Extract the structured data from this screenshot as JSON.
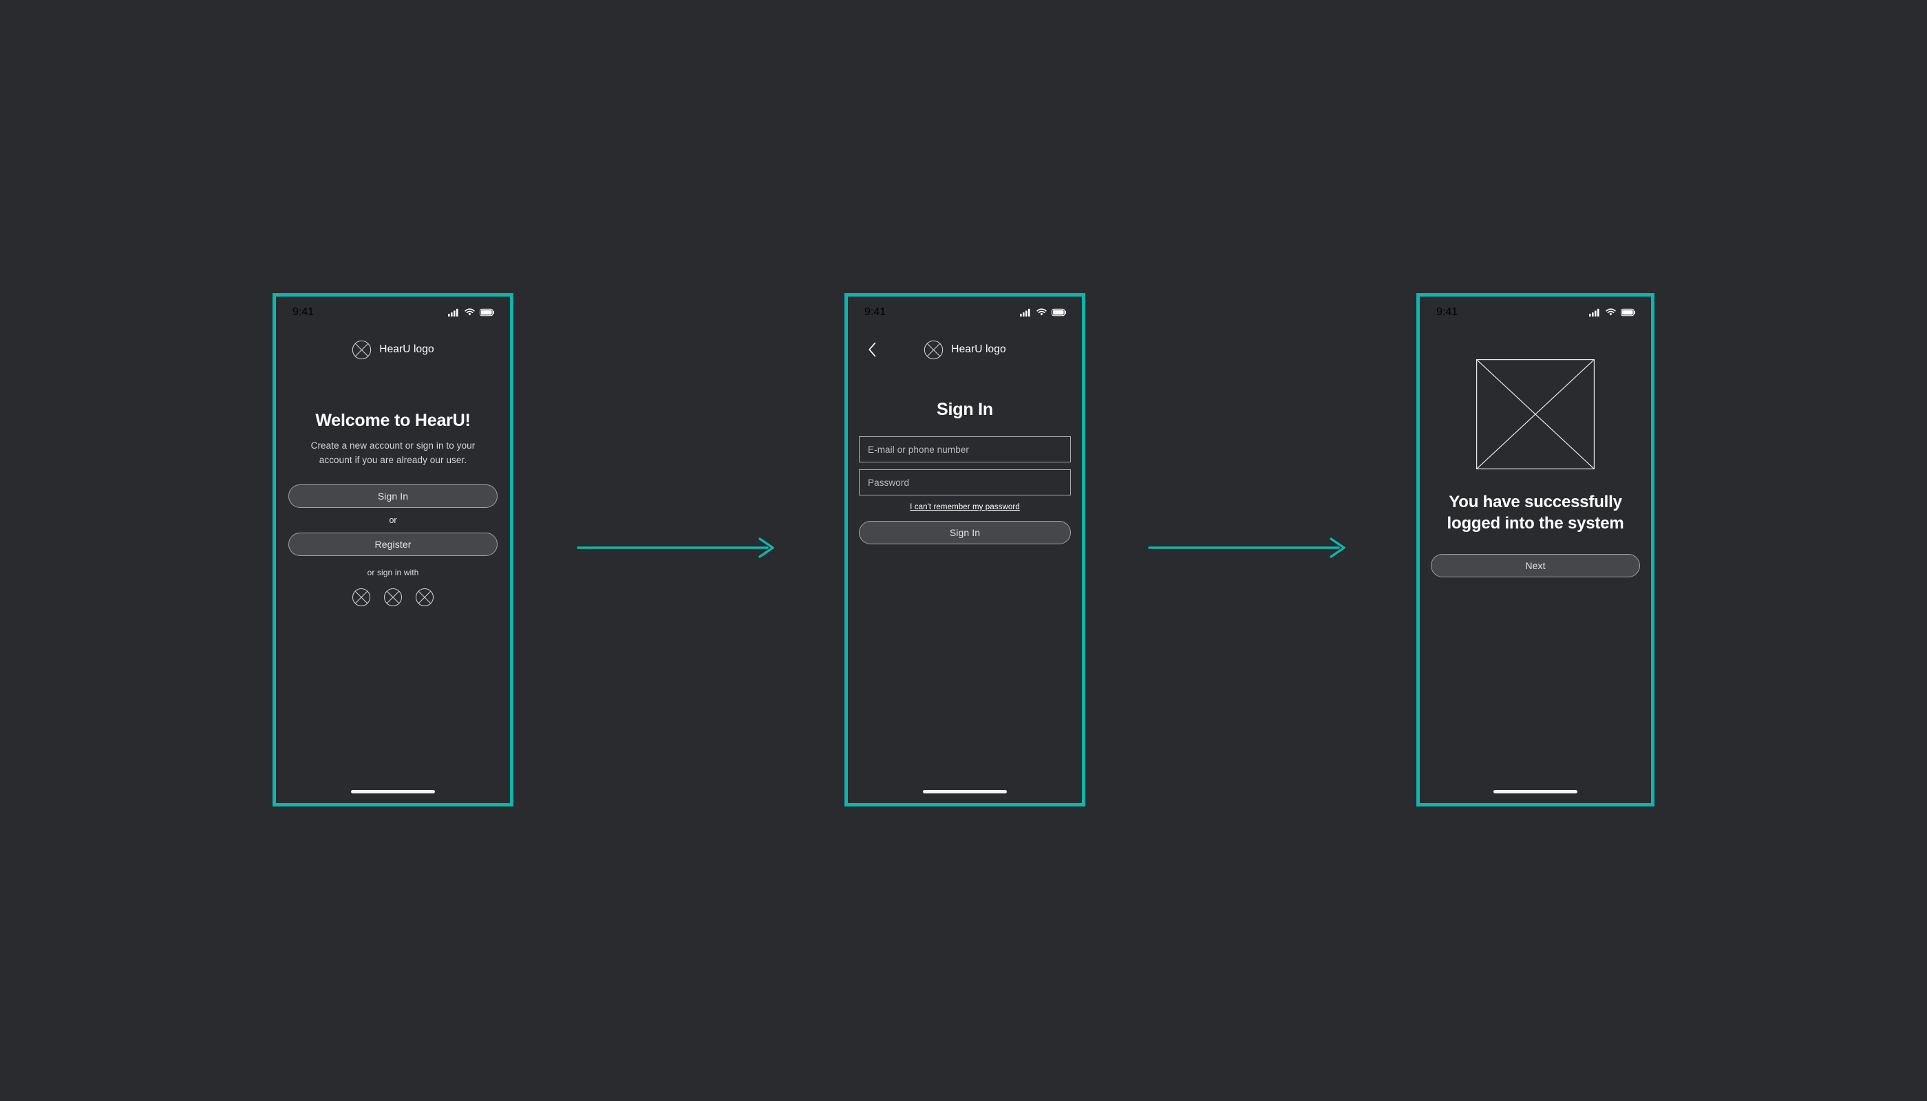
{
  "theme": {
    "background": "#292b2f",
    "accent": "#11b5ab",
    "button_fill": "#45474b",
    "stroke": "#a8abaf",
    "text": "#ffffff"
  },
  "status_bar": {
    "time": "9:41",
    "cellular_icon": "cellular-signal-icon",
    "wifi_icon": "wifi-icon",
    "battery_icon": "battery-icon"
  },
  "screens": [
    {
      "name": "welcome",
      "brand": {
        "logo_icon": "hearu-logo-placeholder-icon",
        "label": "HearU logo"
      },
      "headline": "Welcome to HearU!",
      "subtext": "Create a new account or sign in to your account if you are already our user.",
      "primary_button": "Sign In",
      "divider_label": "or",
      "secondary_button": "Register",
      "social_prompt": "or sign in with",
      "social_icons": [
        "social-provider-1-icon",
        "social-provider-2-icon",
        "social-provider-3-icon"
      ]
    },
    {
      "name": "sign-in",
      "back_icon": "chevron-left-icon",
      "brand": {
        "logo_icon": "hearu-logo-placeholder-icon",
        "label": "HearU logo"
      },
      "headline": "Sign In",
      "fields": [
        {
          "name": "email-or-phone",
          "value": "",
          "placeholder": "E-mail or phone number"
        },
        {
          "name": "password",
          "value": "",
          "placeholder": "Password"
        }
      ],
      "forgot_link": "I can't remember my password",
      "primary_button": "Sign In"
    },
    {
      "name": "success",
      "image_placeholder_icon": "image-placeholder-icon",
      "headline": "You have successfully logged into the system",
      "primary_button": "Next"
    }
  ],
  "flow_arrows": [
    {
      "name": "arrow-welcome-to-signin",
      "icon": "arrow-right-icon"
    },
    {
      "name": "arrow-signin-to-success",
      "icon": "arrow-right-icon"
    }
  ]
}
